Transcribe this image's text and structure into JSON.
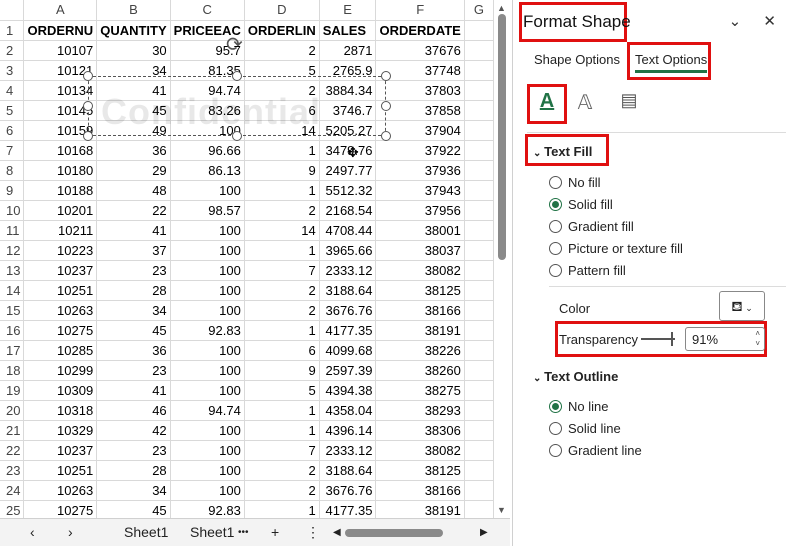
{
  "columns": [
    "A",
    "B",
    "C",
    "D",
    "E",
    "F",
    "G"
  ],
  "header_row": [
    "ORDERNU",
    "QUANTITY",
    "PRICEEAC",
    "ORDERLIN",
    "SALES",
    "ORDERDATE",
    ""
  ],
  "rows": [
    [
      "10107",
      "30",
      "95.7",
      "2",
      "2871",
      "37676"
    ],
    [
      "10121",
      "34",
      "81.35",
      "5",
      "2765.9",
      "37748"
    ],
    [
      "10134",
      "41",
      "94.74",
      "2",
      "3884.34",
      "37803"
    ],
    [
      "10145",
      "45",
      "83.26",
      "6",
      "3746.7",
      "37858"
    ],
    [
      "10159",
      "49",
      "100",
      "14",
      "5205.27",
      "37904"
    ],
    [
      "10168",
      "36",
      "96.66",
      "1",
      "3479.76",
      "37922"
    ],
    [
      "10180",
      "29",
      "86.13",
      "9",
      "2497.77",
      "37936"
    ],
    [
      "10188",
      "48",
      "100",
      "1",
      "5512.32",
      "37943"
    ],
    [
      "10201",
      "22",
      "98.57",
      "2",
      "2168.54",
      "37956"
    ],
    [
      "10211",
      "41",
      "100",
      "14",
      "4708.44",
      "38001"
    ],
    [
      "10223",
      "37",
      "100",
      "1",
      "3965.66",
      "38037"
    ],
    [
      "10237",
      "23",
      "100",
      "7",
      "2333.12",
      "38082"
    ],
    [
      "10251",
      "28",
      "100",
      "2",
      "3188.64",
      "38125"
    ],
    [
      "10263",
      "34",
      "100",
      "2",
      "3676.76",
      "38166"
    ],
    [
      "10275",
      "45",
      "92.83",
      "1",
      "4177.35",
      "38191"
    ],
    [
      "10285",
      "36",
      "100",
      "6",
      "4099.68",
      "38226"
    ],
    [
      "10299",
      "23",
      "100",
      "9",
      "2597.39",
      "38260"
    ],
    [
      "10309",
      "41",
      "100",
      "5",
      "4394.38",
      "38275"
    ],
    [
      "10318",
      "46",
      "94.74",
      "1",
      "4358.04",
      "38293"
    ],
    [
      "10329",
      "42",
      "100",
      "1",
      "4396.14",
      "38306"
    ],
    [
      "10237",
      "23",
      "100",
      "7",
      "2333.12",
      "38082"
    ],
    [
      "10251",
      "28",
      "100",
      "2",
      "3188.64",
      "38125"
    ],
    [
      "10263",
      "34",
      "100",
      "2",
      "3676.76",
      "38166"
    ],
    [
      "10275",
      "45",
      "92.83",
      "1",
      "4177.35",
      "38191"
    ]
  ],
  "watermark_text": "Confidential",
  "sheet_tabs": [
    "Sheet1",
    "Sheet1"
  ],
  "tabs_more": "•••",
  "tabs_add": "+",
  "tabs_options": "⋮",
  "pane": {
    "title": "Format Shape",
    "tabs": [
      "Shape Options",
      "Text Options"
    ],
    "text_fill_label": "Text Fill",
    "fill_options": [
      "No fill",
      "Solid fill",
      "Gradient fill",
      "Picture or texture fill",
      "Pattern fill"
    ],
    "selected_fill": 1,
    "color_label": "Color",
    "transparency_label": "Transparency",
    "transparency_value": "91%",
    "text_outline_label": "Text Outline",
    "outline_options": [
      "No line",
      "Solid line",
      "Gradient line"
    ],
    "selected_outline": 0
  },
  "accent_color": "#217346",
  "highlight_color": "#e01010"
}
